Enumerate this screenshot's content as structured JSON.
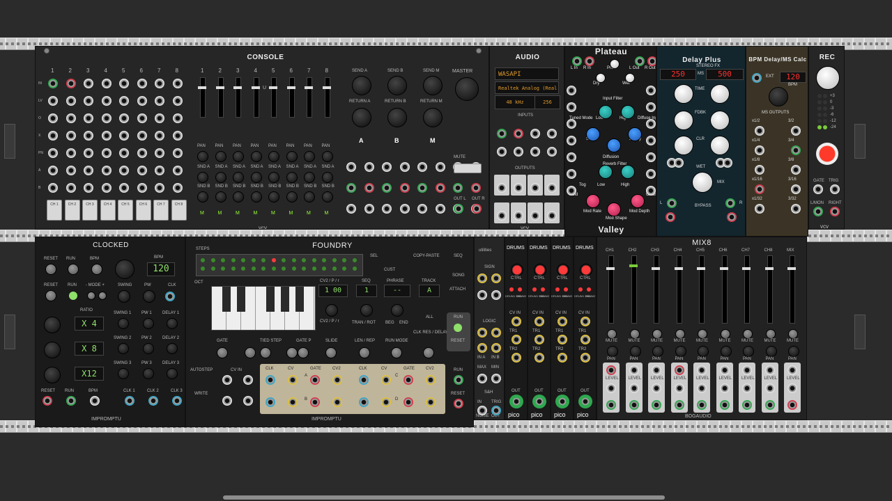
{
  "console": {
    "title": "CONSOLE",
    "channels": [
      "1",
      "2",
      "3",
      "4",
      "5",
      "6",
      "7",
      "8"
    ],
    "row_labels": [
      "IN",
      "LV",
      "O",
      "X",
      "PN",
      "A",
      "B"
    ],
    "sends": [
      "SEND A",
      "SEND B",
      "SEND M"
    ],
    "returns": [
      "RETURN A",
      "RETURN B",
      "RETURN M"
    ],
    "bus_letters": [
      "A",
      "B",
      "M"
    ],
    "master_label": "MASTER",
    "mute_label": "MUTE",
    "ch_buttons": [
      "CH 1",
      "CH 2",
      "CH 3",
      "CH 4",
      "CH 5",
      "CH 6",
      "CH 7",
      "CH 8"
    ],
    "pan_label": "PAN",
    "snd_a": "SND A",
    "snd_b": "SND B",
    "m_label": "M",
    "u_label": "U",
    "out_labels": [
      "OUT L",
      "OUT R"
    ],
    "brand": "vcv"
  },
  "audio": {
    "title": "AUDIO",
    "driver": "WASAPI",
    "device": "Realtek Analog (Real",
    "rate": "48 kHz",
    "block": "256",
    "inputs_label": "INPUTS",
    "outputs_label": "OUTPUTS",
    "brand": "vcv"
  },
  "plateau": {
    "title": "Plateau",
    "footer": "Valley",
    "labels": [
      "L In",
      "R In",
      "PreD",
      "L Out",
      "R Out",
      "Dry",
      "Wet",
      "Input Filter",
      "Tuned Mode",
      "Low",
      "High",
      "Diffuse Input",
      "Size",
      "Decay",
      "Diffusion",
      "Reverb Filter",
      "Tog",
      "Low",
      "High",
      "Hold",
      "Clear",
      "Mod Rate",
      "Mod Shape",
      "Mod Depth"
    ]
  },
  "delay": {
    "title": "Delay Plus",
    "subtitle": "STEREO FX",
    "display_left": "250",
    "display_ms": "MS",
    "display_right": "500",
    "knobs": [
      "TIME",
      "FDBK",
      "CLR",
      "MIX"
    ],
    "bypass": "BYPASS",
    "wet": "WET",
    "lr": [
      "L",
      "R"
    ]
  },
  "bpm": {
    "title": "BPM Delay/MS Calc",
    "ext": "EXT",
    "bpm_value": "120",
    "bpm_label": "BPM",
    "ms_outputs": "MS OUTPUTS",
    "divisions": [
      "x1/2",
      "3/2",
      "x1/4",
      "3/4",
      "x1/8",
      "3/8",
      "x1/16",
      "3/16",
      "x1/32",
      "3/32"
    ]
  },
  "rec": {
    "title": "REC",
    "levels": [
      "+3",
      "0",
      "-3",
      "-6",
      "-12",
      "-24"
    ],
    "gate": "GATE",
    "trig": "TRIG",
    "l_mon": "L/MON",
    "right": "RIGHT",
    "brand": "vcv"
  },
  "clocked": {
    "title": "CLOCKED",
    "bpm_display": "120",
    "labels": [
      "RESET",
      "RUN",
      "BPM",
      "RESET",
      "RUN",
      "- MODE +",
      "SWING",
      "PW",
      "CLK",
      "RATIO",
      "SWING 1",
      "PW 1",
      "DELAY 1",
      "SWING 2",
      "PW 2",
      "DELAY 2",
      "SWING 3",
      "PW 3",
      "DELAY 3"
    ],
    "ratios": [
      "X 4",
      "X 8",
      "X12"
    ],
    "bottom": [
      "RESET",
      "RUN",
      "BPM",
      "CLK 1",
      "CLK 2",
      "CLK 3"
    ],
    "brand": "IMPROMPTU"
  },
  "foundry": {
    "title": "FOUNDRY",
    "steps": "STEPS",
    "oct": "OCT",
    "sel": "SEL",
    "cust": "CUST",
    "copy_paste": "COPY-PASTE",
    "seq_song": [
      "SEQ",
      "SONG"
    ],
    "cv2": "CV2 / P / r",
    "seq_display": "1 00",
    "seq": "SEQ",
    "seq_value": "1",
    "phrase": "PHRASE",
    "phrase_value": "--",
    "track": "TRACK",
    "track_value": "A",
    "attach": "ATTACH",
    "all": "ALL",
    "run": "RUN",
    "reset": "RESET",
    "clk_res": "CLK RES / DELAY",
    "gate": "GATE",
    "tied_step": "TIED STEP",
    "gate_p": "GATE P",
    "slide": "SLIDE",
    "len_rep": "LEN / REP",
    "run_mode": "RUN MODE",
    "tran_rot": "TRAN / ROT",
    "beg": "BEG",
    "end": "END",
    "autostep": "AUTOSTEP",
    "write": "WRITE",
    "cv_in": "CV IN",
    "track_cols": [
      "CLK",
      "CV",
      "GATE",
      "CV2",
      "CLK",
      "CV",
      "GATE",
      "CV2"
    ],
    "track_letters": [
      "A",
      "B",
      "C",
      "D"
    ],
    "brand": "IMPROMPTU"
  },
  "utilities": {
    "title": "utilities",
    "labels": [
      "SIGN",
      "LOGIC",
      "IN A",
      "IN B",
      "MAX",
      "MIN",
      "S&H",
      "IN",
      "TRIG",
      "NOISE",
      "OUT"
    ]
  },
  "drums": {
    "title": "DRUMS",
    "labels": [
      "CTRL",
      "DRUM1 SND",
      "DRUM2 EXCL",
      "CV IN",
      "TR1",
      "TR2",
      "OUT"
    ],
    "brand": "pico",
    "count": 4
  },
  "mix8": {
    "title": "MIX8",
    "channels": [
      "CH1",
      "CH2",
      "CH3",
      "CH4",
      "CH5",
      "CH6",
      "CH7",
      "CH8",
      "MIX"
    ],
    "mute": "MUTE",
    "pan": "PAN",
    "level": "LEVEL",
    "brand": "BOGAUDIO"
  }
}
